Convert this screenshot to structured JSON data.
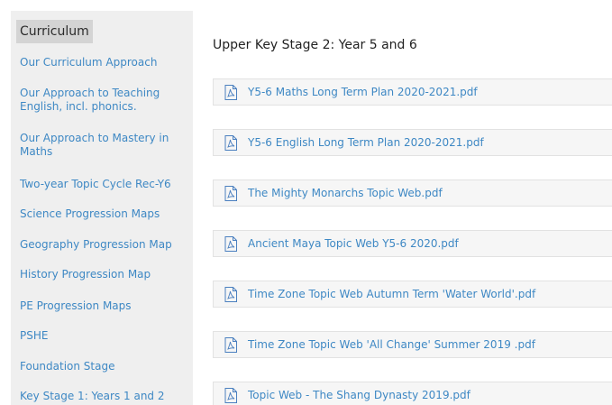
{
  "sidebar": {
    "heading": "Curriculum",
    "items": [
      {
        "label": "Our Curriculum Approach"
      },
      {
        "label": "Our Approach to Teaching English, incl. phonics."
      },
      {
        "label": "Our Approach to Mastery in Maths"
      },
      {
        "label": "Two-year Topic Cycle Rec-Y6"
      },
      {
        "label": "Science Progression Maps"
      },
      {
        "label": "Geography Progression Map"
      },
      {
        "label": "History Progression Map"
      },
      {
        "label": "PE Progression Maps"
      },
      {
        "label": "PSHE"
      },
      {
        "label": "Foundation Stage"
      },
      {
        "label": "Key Stage 1: Years 1 and 2"
      }
    ]
  },
  "main": {
    "title": "Upper Key Stage 2: Year 5 and 6",
    "files": [
      {
        "name": "Y5-6 Maths Long Term Plan 2020-2021.pdf",
        "icon": "pdf-icon"
      },
      {
        "name": "Y5-6 English Long Term Plan 2020-2021.pdf",
        "icon": "pdf-icon"
      },
      {
        "name": "The Mighty Monarchs Topic Web.pdf",
        "icon": "pdf-icon"
      },
      {
        "name": "Ancient Maya Topic Web Y5-6 2020.pdf",
        "icon": "pdf-icon"
      },
      {
        "name": "Time Zone Topic Web Autumn Term 'Water World'.pdf",
        "icon": "pdf-icon"
      },
      {
        "name": "Time Zone Topic Web 'All Change' Summer 2019 .pdf",
        "icon": "pdf-icon"
      },
      {
        "name": "Topic Web - The Shang Dynasty 2019.pdf",
        "icon": "pdf-icon"
      }
    ]
  },
  "colors": {
    "link": "#3e88c4",
    "sidebar_bg": "#efefef",
    "heading_highlight": "#d4d4d4",
    "row_bg": "#f6f6f6"
  }
}
